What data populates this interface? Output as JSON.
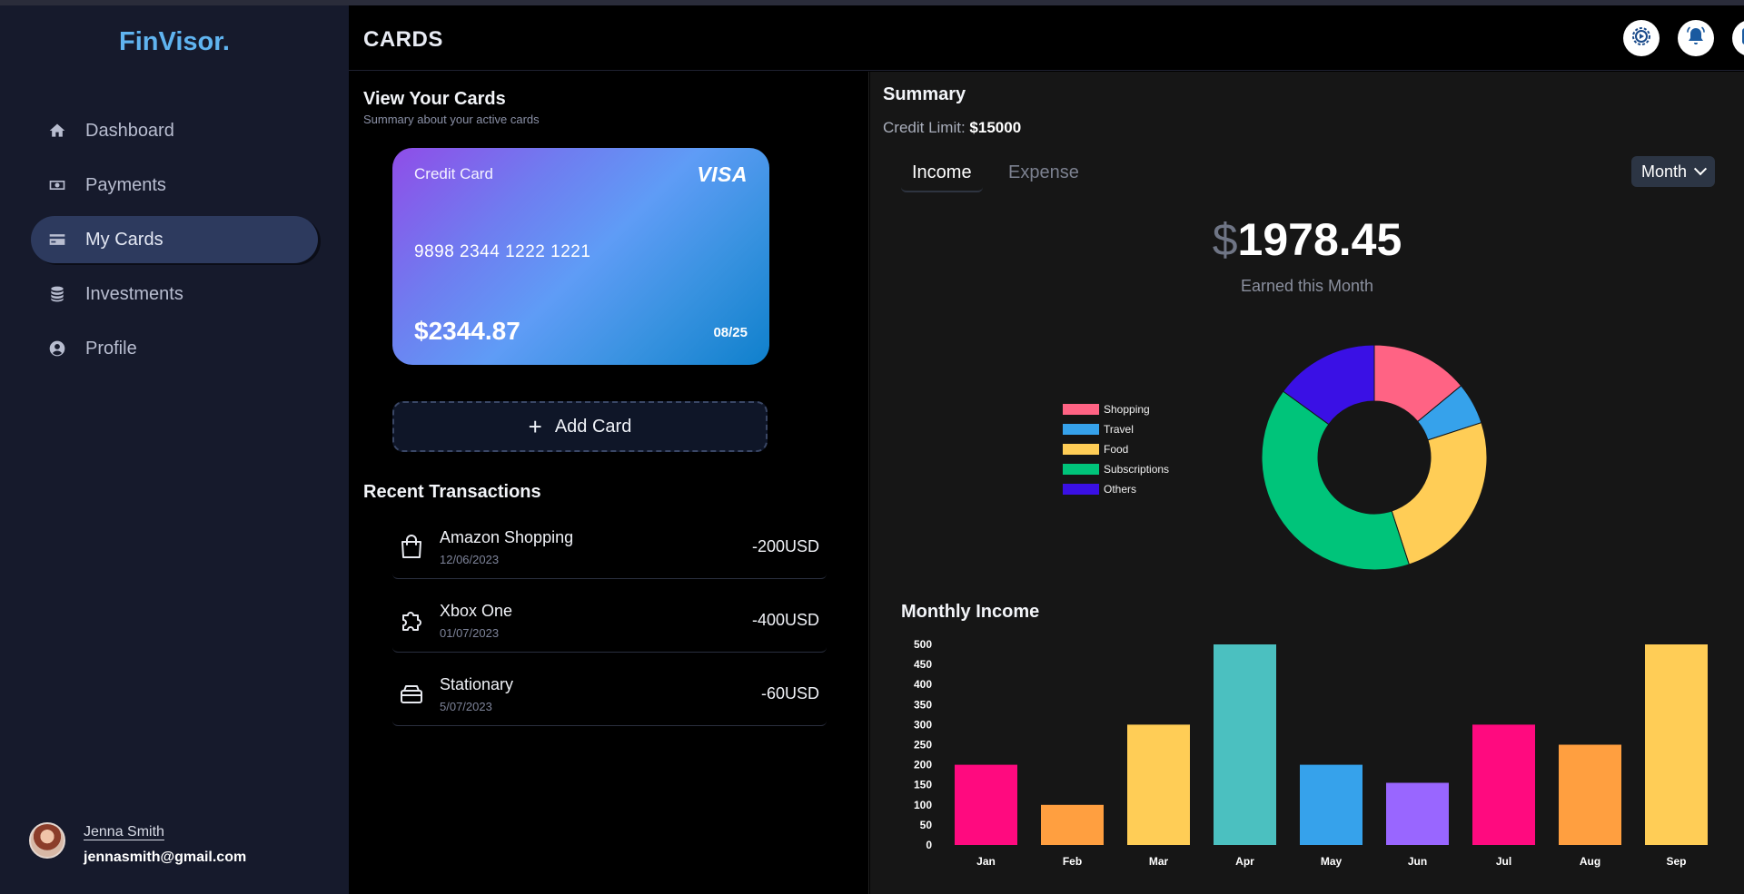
{
  "app": {
    "logo": "FinVisor."
  },
  "sidebar": {
    "items": [
      {
        "label": "Dashboard",
        "icon": "home-icon",
        "active": false
      },
      {
        "label": "Payments",
        "icon": "money-icon",
        "active": false
      },
      {
        "label": "My Cards",
        "icon": "card-icon",
        "active": true
      },
      {
        "label": "Investments",
        "icon": "coins-stack-icon",
        "active": false
      },
      {
        "label": "Profile",
        "icon": "user-circle-icon",
        "active": false
      }
    ],
    "user": {
      "name": "Jenna Smith",
      "email": "jennasmith@gmail.com"
    }
  },
  "header": {
    "title": "CARDS",
    "buttons": [
      "settings-icon",
      "bell-icon",
      "logout-icon"
    ]
  },
  "cards_section": {
    "title": "View Your Cards",
    "subtitle": "Summary about your active cards",
    "card": {
      "type": "Credit Card",
      "brand": "VISA",
      "number": "9898 2344 1222 1221",
      "balance": "$2344.87",
      "expiry": "08/25"
    },
    "add_card_label": "Add Card"
  },
  "transactions": {
    "title": "Recent Transactions",
    "items": [
      {
        "name": "Amazon Shopping",
        "date": "12/06/2023",
        "amount": "-200USD",
        "icon": "shopping-bag-icon"
      },
      {
        "name": "Xbox One",
        "date": "01/07/2023",
        "amount": "-400USD",
        "icon": "puzzle-icon"
      },
      {
        "name": "Stationary",
        "date": "5/07/2023",
        "amount": "-60USD",
        "icon": "tray-icon"
      }
    ]
  },
  "summary": {
    "title": "Summary",
    "credit_limit_label": "Credit Limit:",
    "credit_limit_value": "$15000",
    "tabs": [
      "Income",
      "Expense"
    ],
    "active_tab": "Income",
    "period": "Month",
    "currency_symbol": "$",
    "amount": "1978.45",
    "amount_caption": "Earned this Month"
  },
  "chart_data": [
    {
      "type": "pie",
      "variant": "doughnut",
      "labels": [
        "Shopping",
        "Travel",
        "Food",
        "Subscriptions",
        "Others"
      ],
      "values": [
        14,
        6,
        25,
        40,
        15
      ],
      "colors": [
        "#ff6384",
        "#36a2eb",
        "#ffcd56",
        "#00c47a",
        "#3a10e5"
      ],
      "legend": "left"
    },
    {
      "type": "bar",
      "title": "Monthly Income",
      "categories": [
        "Jan",
        "Feb",
        "Mar",
        "Apr",
        "May",
        "Jun",
        "Jul",
        "Aug",
        "Sep"
      ],
      "values": [
        200,
        100,
        300,
        500,
        200,
        155,
        300,
        250,
        500
      ],
      "colors": [
        "#ff0a7f",
        "#ff9f40",
        "#ffcd56",
        "#4bc0c0",
        "#36a2eb",
        "#9966ff",
        "#ff0a7f",
        "#ff9f40",
        "#ffcd56"
      ],
      "ylim": [
        0,
        500
      ],
      "yticks": [
        0,
        50,
        100,
        150,
        200,
        250,
        300,
        350,
        400,
        450,
        500
      ],
      "grid": false
    }
  ]
}
